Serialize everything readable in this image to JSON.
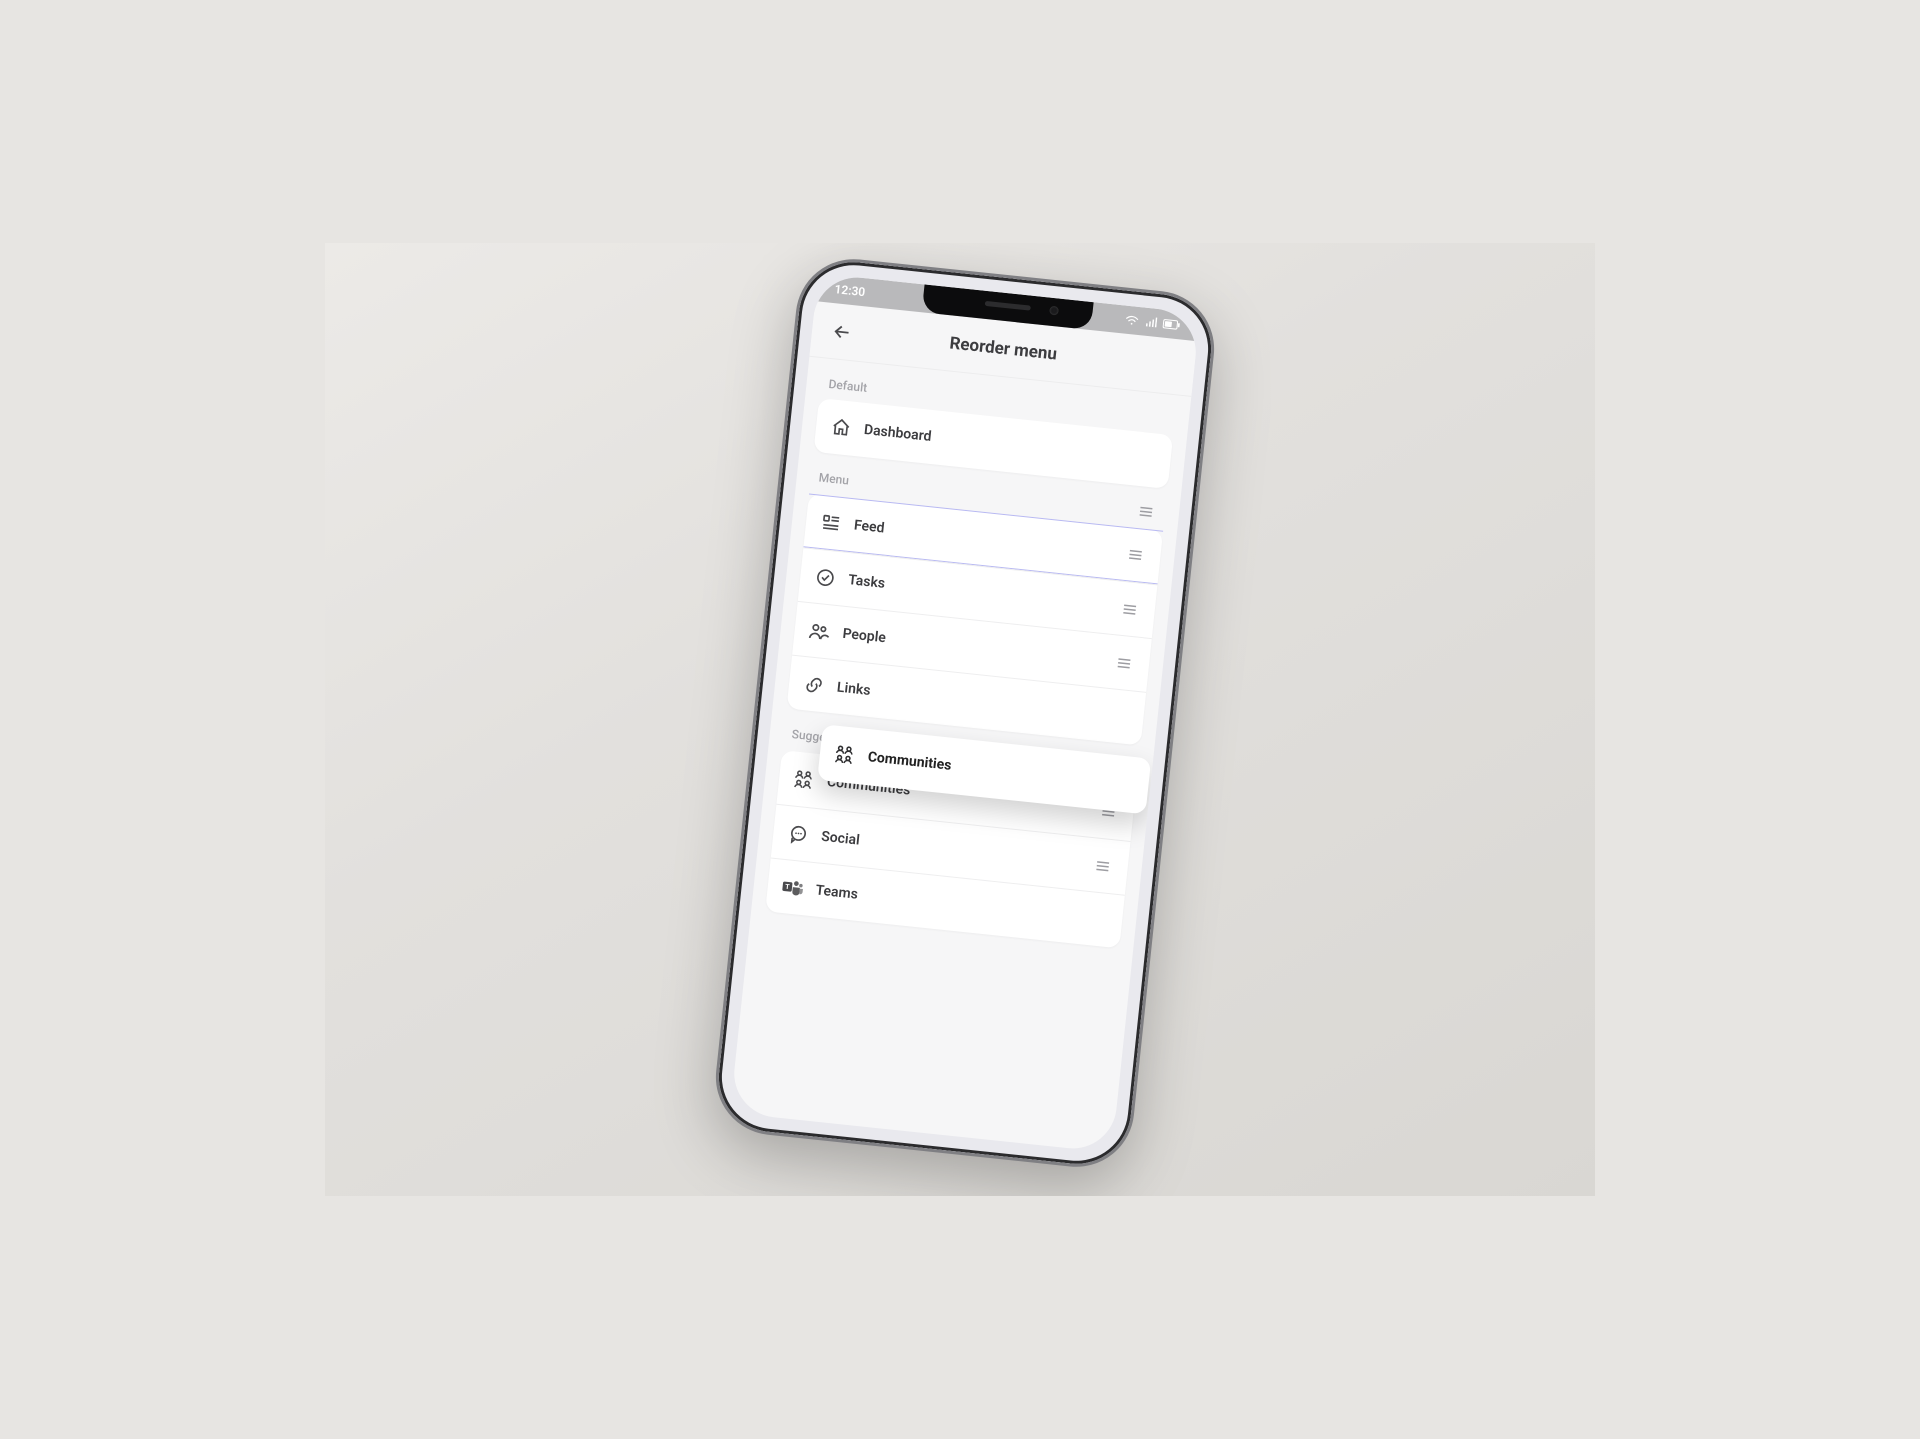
{
  "statusbar": {
    "time": "12:30"
  },
  "header": {
    "title": "Reorder menu"
  },
  "sections": {
    "default": {
      "label": "Default",
      "item": {
        "label": "Dashboard",
        "icon": "home-icon"
      }
    },
    "menu": {
      "label": "Menu",
      "items": [
        {
          "label": "Feed",
          "icon": "feed-icon"
        },
        {
          "label": "Tasks",
          "icon": "check-circle-icon"
        },
        {
          "label": "People",
          "icon": "people-icon"
        },
        {
          "label": "Links",
          "icon": "link-icon"
        }
      ]
    },
    "suggested": {
      "label": "Suggested",
      "items": [
        {
          "label": "Communities",
          "icon": "communities-icon"
        },
        {
          "label": "Social",
          "icon": "chat-icon"
        },
        {
          "label": "Teams",
          "icon": "teams-icon"
        }
      ]
    }
  },
  "dragging": {
    "label": "Communities",
    "icon": "communities-icon"
  },
  "colors": {
    "highlight_border": "#b8b9f2",
    "teams": "#6264a7"
  }
}
